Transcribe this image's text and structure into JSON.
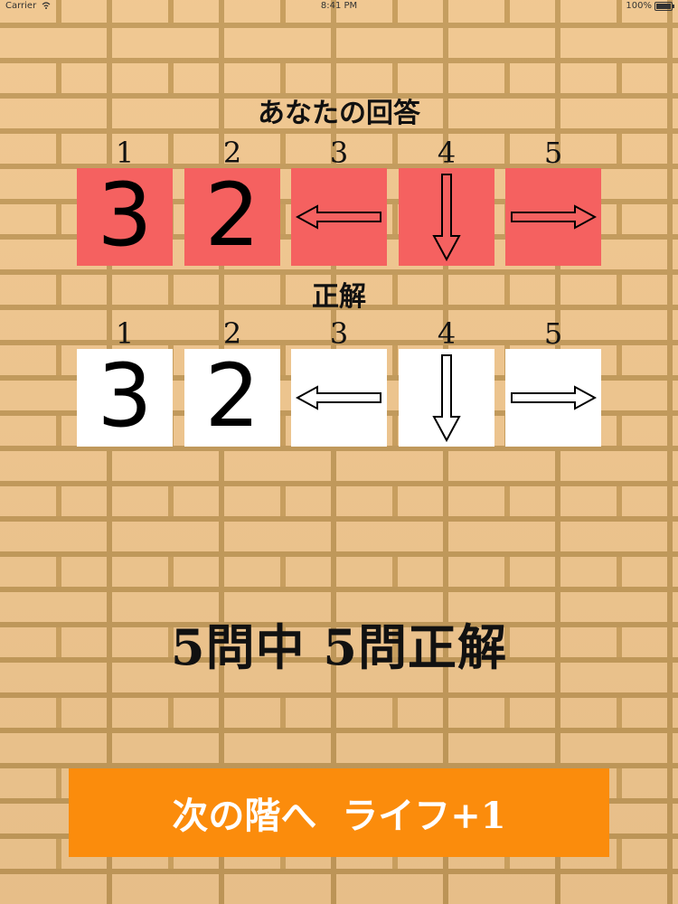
{
  "status_bar": {
    "carrier": "Carrier",
    "time": "8:41 PM",
    "battery": "100%",
    "battery_level": 1.0
  },
  "your_answer": {
    "title": "あなたの回答",
    "numbers": [
      "1",
      "2",
      "3",
      "4",
      "5"
    ],
    "tiles": [
      {
        "kind": "digit",
        "value": "3"
      },
      {
        "kind": "digit",
        "value": "2"
      },
      {
        "kind": "arrow",
        "icon": "arrow-left-icon"
      },
      {
        "kind": "arrow",
        "icon": "arrow-down-icon"
      },
      {
        "kind": "arrow",
        "icon": "arrow-right-icon"
      }
    ],
    "tile_color": "#f56160"
  },
  "correct_answer": {
    "title": "正解",
    "numbers": [
      "1",
      "2",
      "3",
      "4",
      "5"
    ],
    "tiles": [
      {
        "kind": "digit",
        "value": "3"
      },
      {
        "kind": "digit",
        "value": "2"
      },
      {
        "kind": "arrow",
        "icon": "arrow-left-icon"
      },
      {
        "kind": "arrow",
        "icon": "arrow-down-icon"
      },
      {
        "kind": "arrow",
        "icon": "arrow-right-icon"
      }
    ],
    "tile_color": "#ffffff"
  },
  "result": {
    "score_text": "5問中 5問正解"
  },
  "next_button": {
    "label": "次の階へ  ライフ+1",
    "color": "#fb8c0c"
  }
}
